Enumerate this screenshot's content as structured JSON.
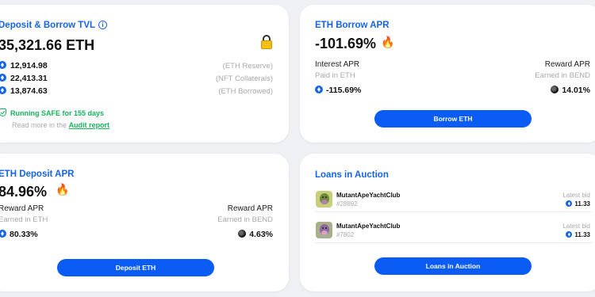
{
  "tvl": {
    "title": "Deposit & Borrow TVL",
    "value": "35,321.66 ETH",
    "rows": [
      {
        "value": "12,914.98",
        "label": "(ETH Reserve)"
      },
      {
        "value": "22,413.31",
        "label": "(NFT Collaterals)"
      },
      {
        "value": "13,874.63",
        "label": "(ETH Borrowed)"
      }
    ],
    "safe_text": "Running SAFE for 155 days",
    "read_more": "Read more in the",
    "audit_link": "Audit report",
    "icons": {
      "info": "info-icon",
      "lock": "lock-icon",
      "shield": "shield-check-icon",
      "token": "eth-icon"
    }
  },
  "borrow": {
    "title": "ETH Borrow APR",
    "value": "-101.69%",
    "left_label": "Interest APR",
    "left_sub": "Paid in ETH",
    "left_value": "-115.69%",
    "right_label": "Reward APR",
    "right_sub": "Earned in BEND",
    "right_value": "14.01%",
    "button": "Borrow ETH"
  },
  "deposit": {
    "title": "ETH Deposit APR",
    "value": "84.96%",
    "left_label": "Reward APR",
    "left_sub": "Earned in ETH",
    "left_value": "80.33%",
    "right_label": "Reward APR",
    "right_sub": "Earned in BEND",
    "right_value": "4.63%",
    "button": "Deposit ETH"
  },
  "auction": {
    "title": "Loans in Auction",
    "bid_label": "Latest bid",
    "items": [
      {
        "name": "MutantApeYachtClub",
        "id": "#28892",
        "bid": "11.33"
      },
      {
        "name": "MutantApeYachtClub",
        "id": "#7802",
        "bid": "11.33"
      }
    ],
    "button": "Loans in Auction"
  },
  "colors": {
    "accent": "#1565e6",
    "button": "#0a5cf5",
    "safe": "#16b35b",
    "background": "#eef0f4"
  }
}
